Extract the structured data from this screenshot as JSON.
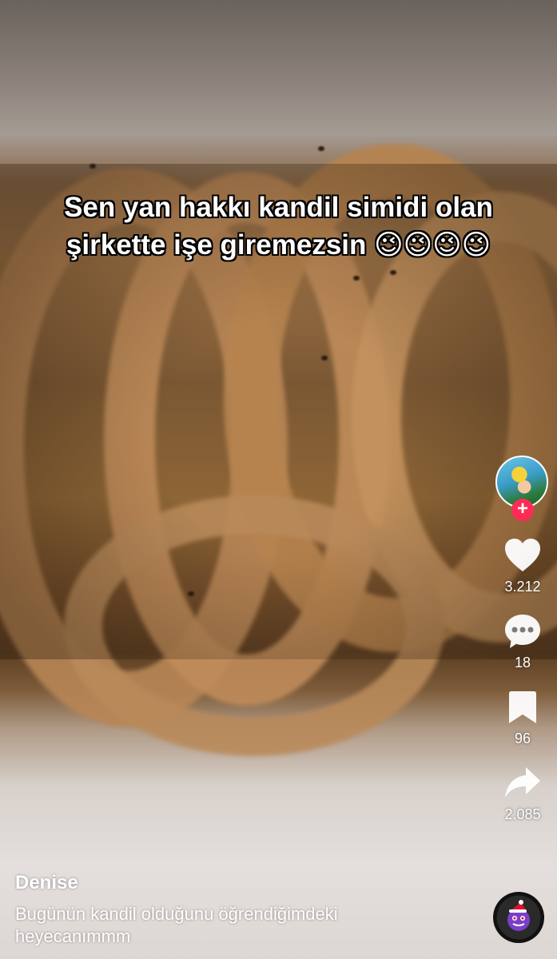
{
  "video": {
    "overlay_text_line1": "Sen yan hakkı kandil simidi olan",
    "overlay_text_line2": "şirkette işe giremezsin 😉😉😉😉"
  },
  "creator": {
    "username": "Denise",
    "avatar_icon": "profile-avatar-icon",
    "follow_icon": "plus-icon",
    "follow_symbol": "+"
  },
  "actions": {
    "like": {
      "icon": "heart-icon",
      "count": "3.212"
    },
    "comment": {
      "icon": "comment-bubble-icon",
      "count": "18"
    },
    "bookmark": {
      "icon": "bookmark-icon",
      "count": "96"
    },
    "share": {
      "icon": "share-arrow-icon",
      "count": "2.085"
    }
  },
  "description_line1": "Bugünün kandil olduğunu öğrendiğimdeki",
  "description_line2": "heyecanımmm",
  "sound": {
    "icon": "sound-disc-icon"
  },
  "colors": {
    "accent": "#fe2c55",
    "text": "#ffffff"
  }
}
